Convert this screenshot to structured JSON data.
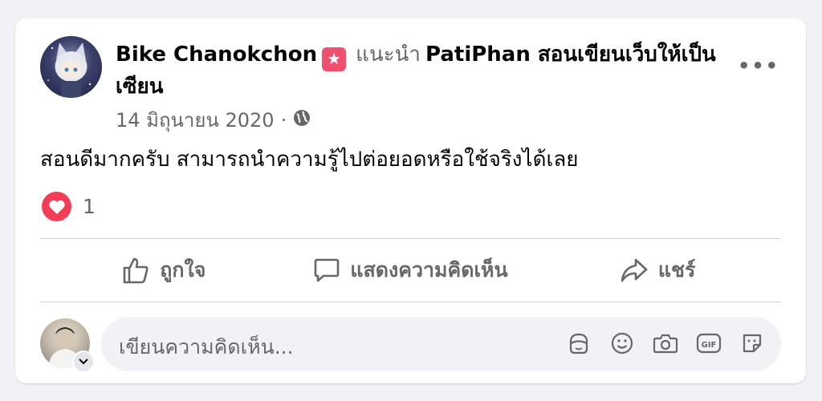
{
  "post": {
    "author": "Bike Chanokchon",
    "verb": "แนะนำ",
    "page_name": "PatiPhan สอนเขียนเว็บให้เป็นเซียน",
    "date": "14 มิถุนายน 2020",
    "separator": "·",
    "privacy_icon": "globe-icon",
    "more_label": "•••",
    "text": "สอนดีมากครับ สามารถนำความรู้ไปต่อยอดหรือใช้จริงได้เลย",
    "reaction_icon": "heart-icon",
    "reaction_count": "1",
    "recommend_badge_icon": "star-icon"
  },
  "actions": {
    "like_label": "ถูกใจ",
    "comment_label": "แสดงความคิดเห็น",
    "share_label": "แชร์"
  },
  "composer": {
    "placeholder": "เขียนความคิดเห็น...",
    "tools": [
      "avatar-sticker-icon",
      "emoji-icon",
      "camera-icon",
      "gif-icon",
      "sticker-icon"
    ],
    "gif_text": "GIF"
  },
  "colors": {
    "background": "#f0f2f5",
    "card": "#ffffff",
    "secondary_text": "#65676b",
    "reaction_love": "#f33e58",
    "badge": "#f0506e"
  }
}
